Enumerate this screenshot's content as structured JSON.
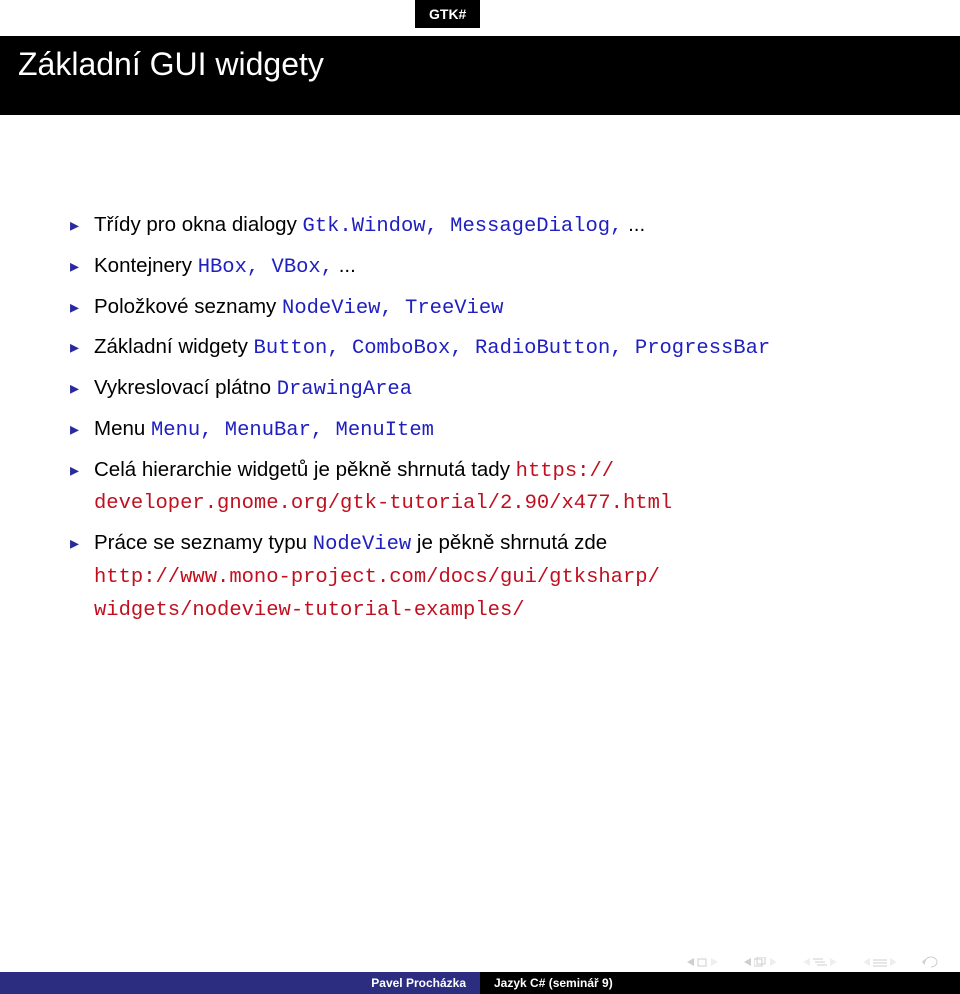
{
  "header": {
    "badge": "GTK#",
    "title": "Základní GUI widgety"
  },
  "bullets": [
    {
      "pre": "Třídy pro okna dialogy ",
      "code": "Gtk.Window, MessageDialog,",
      "post": " ..."
    },
    {
      "pre": "Kontejnery ",
      "code": "HBox, VBox,",
      "post": " ..."
    },
    {
      "pre": "Položkové seznamy ",
      "code": "NodeView, TreeView",
      "post": ""
    },
    {
      "pre": "Základní widgety ",
      "code": "Button, ComboBox, RadioButton, ProgressBar",
      "post": ""
    },
    {
      "pre": "Vykreslovací plátno ",
      "code": "DrawingArea",
      "post": ""
    },
    {
      "pre": "Menu ",
      "code": "Menu, MenuBar, MenuItem",
      "post": ""
    }
  ],
  "link1": {
    "pre": "Celá hierarchie widgetů je pěkně shrnutá tady ",
    "url1": "https://",
    "url2": "developer.gnome.org/gtk-tutorial/2.90/x477.html"
  },
  "link2": {
    "pre1": "Práce se seznamy typu ",
    "code": "NodeView",
    "pre2": " je pěkně shrnutá zde",
    "url1": "http://www.mono-project.com/docs/gui/gtksharp/",
    "url2": "widgets/nodeview-tutorial-examples/"
  },
  "footer": {
    "author": "Pavel Procházka",
    "talk": "Jazyk C# (seminář 9)"
  }
}
